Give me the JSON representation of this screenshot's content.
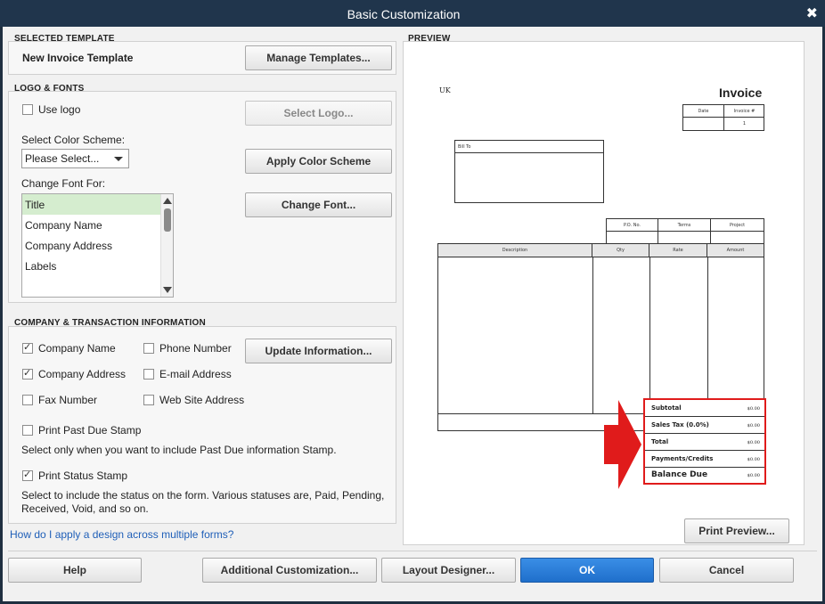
{
  "window": {
    "title": "Basic Customization",
    "close_glyph": "✖"
  },
  "selected_template": {
    "section": "SELECTED TEMPLATE",
    "name": "New Invoice Template",
    "manage_button": "Manage Templates..."
  },
  "logo_fonts": {
    "section": "LOGO & FONTS",
    "use_logo": {
      "label": "Use logo",
      "checked": false
    },
    "select_logo_button": "Select Logo...",
    "color_scheme_label": "Select Color Scheme:",
    "color_scheme_value": "Please Select...",
    "apply_color_button": "Apply Color Scheme",
    "change_font_label": "Change Font For:",
    "font_items": [
      "Title",
      "Company Name",
      "Company Address",
      "Labels"
    ],
    "selected_font_item": "Title",
    "change_font_button": "Change Font..."
  },
  "company_info": {
    "section": "COMPANY & TRANSACTION INFORMATION",
    "company_name": {
      "label": "Company Name",
      "checked": true
    },
    "phone_number": {
      "label": "Phone Number",
      "checked": false
    },
    "company_address": {
      "label": "Company Address",
      "checked": true
    },
    "email_address": {
      "label": "E-mail Address",
      "checked": false
    },
    "fax_number": {
      "label": "Fax Number",
      "checked": false
    },
    "web_site": {
      "label": "Web Site Address",
      "checked": false
    },
    "update_button": "Update Information...",
    "past_due": {
      "label": "Print Past Due Stamp",
      "checked": false
    },
    "past_due_help": "Select only when you want to include Past Due information Stamp.",
    "status_stamp": {
      "label": "Print Status Stamp",
      "checked": true
    },
    "status_help_line1": "Select to include the status on the form. Various statuses are, Paid, Pending,",
    "status_help_line2": "Received, Void, and so on."
  },
  "help_link": "How do I apply a design across multiple forms?",
  "preview": {
    "section": "PREVIEW",
    "company": "UK",
    "title": "Invoice",
    "date_header": "Date",
    "invoice_no_header": "Invoice #",
    "invoice_no_value": "1",
    "bill_to": "Bill To",
    "po_header": "P.O. No.",
    "terms_header": "Terms",
    "project_header": "Project",
    "col_description": "Description",
    "col_qty": "Qty",
    "col_rate": "Rate",
    "col_amount": "Amount",
    "totals": [
      {
        "label": "Subtotal",
        "value": "$0.00"
      },
      {
        "label": "Sales Tax  (0.0%)",
        "value": "$0.00"
      },
      {
        "label": "Total",
        "value": "$0.00"
      },
      {
        "label": "Payments/Credits",
        "value": "$0.00"
      },
      {
        "label": "Balance Due",
        "value": "$0.00"
      }
    ],
    "print_preview_button": "Print Preview...",
    "highlight_color": "#e01b1b"
  },
  "footer": {
    "help": "Help",
    "additional": "Additional Customization...",
    "layout": "Layout Designer...",
    "ok": "OK",
    "cancel": "Cancel"
  }
}
